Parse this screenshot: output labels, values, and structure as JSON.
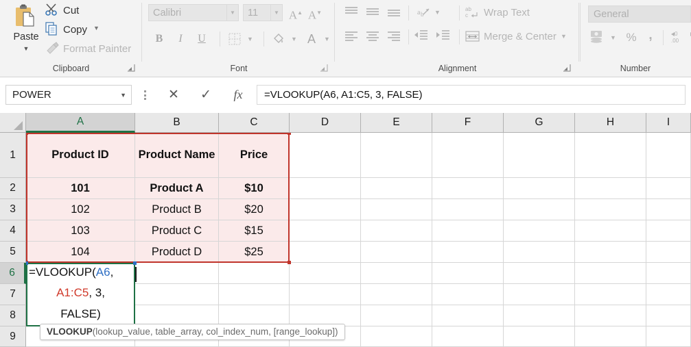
{
  "ribbon": {
    "groups": [
      {
        "label": "Clipboard"
      },
      {
        "label": "Font"
      },
      {
        "label": "Alignment"
      },
      {
        "label": "Number"
      }
    ],
    "clipboard": {
      "paste_label": "Paste",
      "cut_label": "Cut",
      "copy_label": "Copy",
      "format_painter_label": "Format Painter",
      "group_label": "Clipboard"
    },
    "font": {
      "font_name": "Calibri",
      "font_size": "11",
      "grow_font": "A",
      "shrink_font": "A",
      "bold": "B",
      "italic": "I",
      "underline": "U",
      "font_color": "A",
      "group_label": "Font"
    },
    "alignment": {
      "wrap_text_label": "Wrap Text",
      "merge_center_label": "Merge & Center",
      "group_label": "Alignment"
    },
    "number": {
      "format_value": "General",
      "percent": "%",
      "comma": ",",
      "group_label": "Number"
    }
  },
  "formula_bar": {
    "name_box_value": "POWER",
    "cancel_icon": "✕",
    "enter_icon": "✓",
    "fx_label": "fx",
    "formula_value": "=VLOOKUP(A6, A1:C5, 3, FALSE)"
  },
  "sheet": {
    "column_headers": [
      "A",
      "B",
      "C",
      "D",
      "E",
      "F",
      "G",
      "H",
      "I"
    ],
    "selected_column": "A",
    "row_headers": [
      "1",
      "2",
      "3",
      "4",
      "5",
      "6",
      "7",
      "8",
      "9"
    ],
    "selected_row": "6",
    "rows": [
      {
        "id": "1",
        "cells": [
          "Product ID",
          "Product Name",
          "Price"
        ]
      },
      {
        "id": "2",
        "cells": [
          "101",
          "Product A",
          "$10"
        ]
      },
      {
        "id": "3",
        "cells": [
          "102",
          "Product B",
          "$20"
        ]
      },
      {
        "id": "4",
        "cells": [
          "103",
          "Product C",
          "$15"
        ]
      },
      {
        "id": "5",
        "cells": [
          "104",
          "Product D",
          "$25"
        ]
      }
    ]
  },
  "active_cell": {
    "reference": "A6",
    "line1_prefix": "=VLOOKUP(",
    "line1_ref": "A6",
    "line1_suffix": ",",
    "line2_ref": "A1:C5",
    "line2_suffix": ", 3,",
    "line3": "FALSE)"
  },
  "tooltip": {
    "function_name": "VLOOKUP",
    "signature": "(lookup_value, table_array, col_index_num, [range_lookup])"
  },
  "colors": {
    "range_border": "#c0342b",
    "range_fill": "#fbeaea",
    "active_border": "#1e7145",
    "ref_blue": "#2f6fc4",
    "ref_red": "#d03a2b"
  }
}
